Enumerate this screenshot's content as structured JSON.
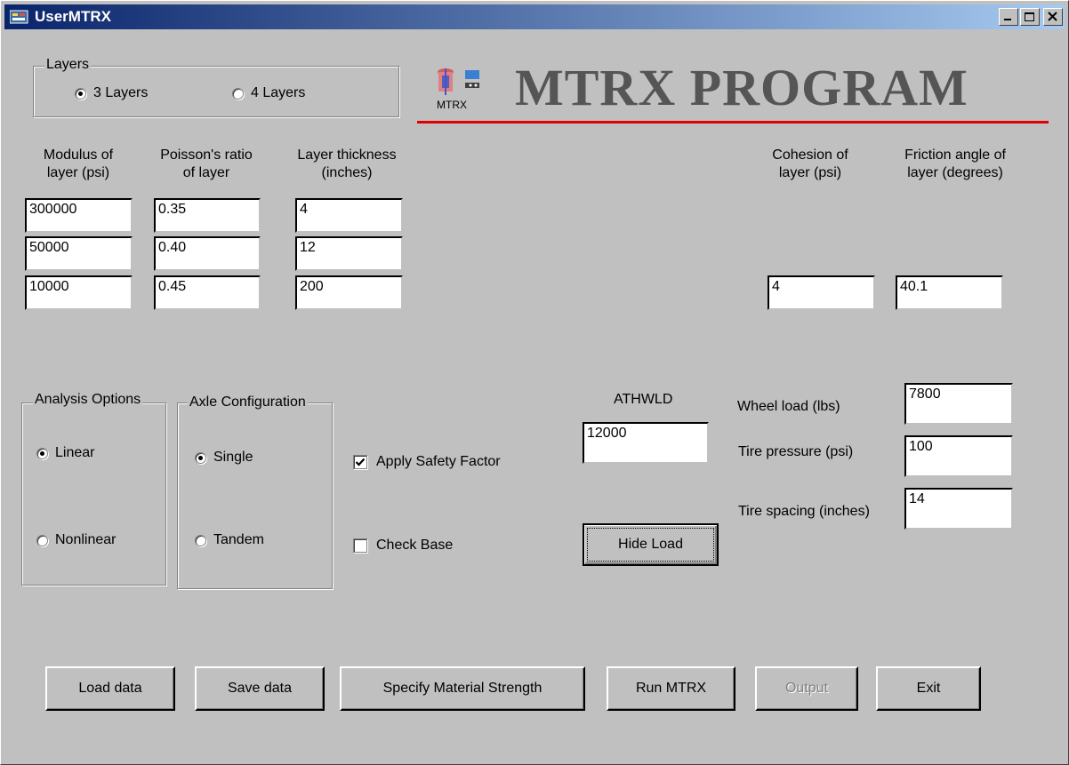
{
  "window": {
    "title": "UserMTRX",
    "icon": "app-icon",
    "controls": [
      "minimize-icon",
      "maximize-icon",
      "close-icon"
    ]
  },
  "layers": {
    "group_label": "Layers",
    "options": [
      {
        "label": "3 Layers",
        "selected": true
      },
      {
        "label": "4 Layers",
        "selected": false
      }
    ]
  },
  "logo": {
    "icon_label": "MTRX",
    "title": "MTRX PROGRAM",
    "line_color": "#e00000"
  },
  "columns": {
    "modulus_header": [
      "Modulus of",
      "layer (psi)"
    ],
    "poisson_header": [
      "Poisson's ratio",
      "of layer"
    ],
    "thickness_header": [
      "Layer thickness",
      "(inches)"
    ],
    "cohesion_header": [
      "Cohesion of",
      "layer (psi)"
    ],
    "friction_header": [
      "Friction angle of",
      "layer (degrees)"
    ]
  },
  "layer_values": {
    "modulus": [
      "300000",
      "50000",
      "10000"
    ],
    "poisson": [
      "0.35",
      "0.40",
      "0.45"
    ],
    "thickness": [
      "4",
      "12",
      "200"
    ],
    "cohesion": "4",
    "friction": "40.1"
  },
  "analysis": {
    "group_label": "Analysis Options",
    "options": [
      {
        "label": "Linear",
        "selected": true
      },
      {
        "label": "Nonlinear",
        "selected": false
      }
    ]
  },
  "axle": {
    "group_label": "Axle Configuration",
    "options": [
      {
        "label": "Single",
        "selected": true
      },
      {
        "label": "Tandem",
        "selected": false
      }
    ]
  },
  "checks": {
    "safety_factor": {
      "label": "Apply Safety Factor",
      "checked": true
    },
    "check_base": {
      "label": "Check Base",
      "checked": false
    }
  },
  "athwld": {
    "label": "ATHWLD",
    "value": "12000"
  },
  "load": {
    "wheel_load_label": "Wheel load (lbs)",
    "wheel_load": "7800",
    "tire_pressure_label": "Tire pressure (psi)",
    "tire_pressure": "100",
    "tire_spacing_label": "Tire spacing (inches)",
    "tire_spacing": "14",
    "hide_load_button": "Hide Load"
  },
  "buttons": {
    "load_data": "Load data",
    "save_data": "Save data",
    "specify_strength": "Specify Material Strength",
    "run": "Run MTRX",
    "output": "Output",
    "exit": "Exit"
  }
}
